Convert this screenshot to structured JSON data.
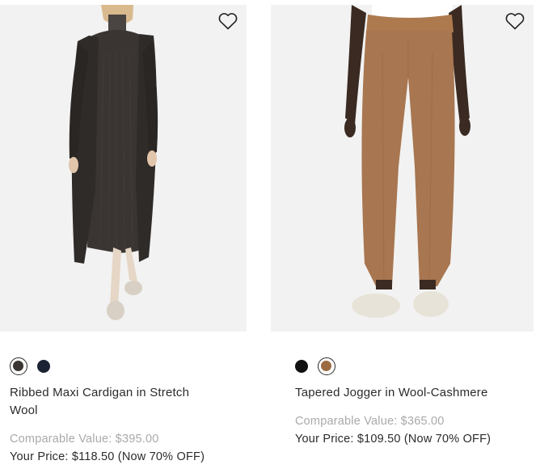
{
  "products": [
    {
      "name": "Ribbed Maxi Cardigan in Stretch Wool",
      "comparable": "Comparable Value: $395.00",
      "price": "Your Price: $118.50 (Now 70% OFF)",
      "swatches": [
        {
          "color": "#3b3633",
          "selected": true
        },
        {
          "color": "#1b2233",
          "selected": false
        }
      ],
      "wishlist_icon": "heart-outline-icon"
    },
    {
      "name": "Tapered Jogger in Wool-Cashmere",
      "comparable": "Comparable Value: $365.00",
      "price": "Your Price: $109.50 (Now 70% OFF)",
      "swatches": [
        {
          "color": "#111111",
          "selected": false
        },
        {
          "color": "#9c6b41",
          "selected": true
        }
      ],
      "wishlist_icon": "heart-outline-icon"
    }
  ]
}
